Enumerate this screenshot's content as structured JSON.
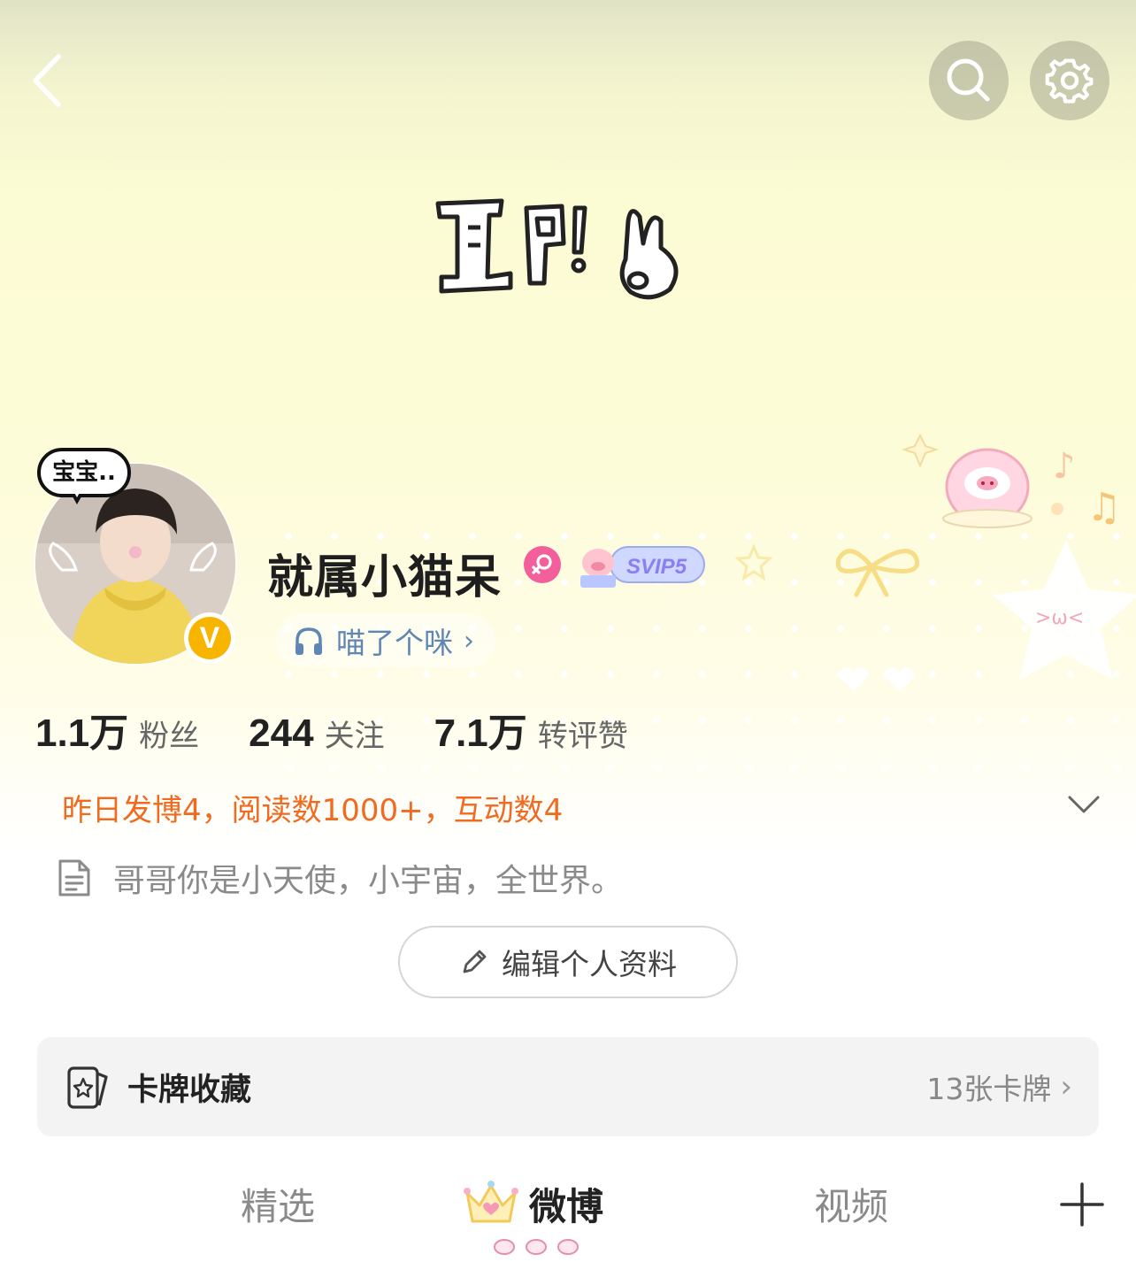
{
  "header": {
    "back_icon": "chevron-left-icon",
    "search_icon": "search-icon",
    "settings_icon": "gear-icon"
  },
  "profile": {
    "avatar_bubble": "宝宝..",
    "verified_badge": "V",
    "username": "就属小猫呆",
    "gender_icon": "female-icon",
    "vip_label": "SVIP5",
    "music_label": "喵了个咪",
    "music_chevron": "›"
  },
  "stats": [
    {
      "value": "1.1万",
      "label": "粉丝"
    },
    {
      "value": "244",
      "label": "关注"
    },
    {
      "value": "7.1万",
      "label": "转评赞"
    }
  ],
  "yesterday_summary": "昨日发博4，阅读数1000+，互动数4",
  "bio": "哥哥你是小天使，小宇宙，全世界。",
  "edit_profile_label": "编辑个人资料",
  "card_collection": {
    "title": "卡牌收藏",
    "count": "13张卡牌",
    "chevron": "›"
  },
  "tabs": [
    {
      "label": "精选",
      "active": false
    },
    {
      "label": "微博",
      "active": true
    },
    {
      "label": "视频",
      "active": false
    }
  ],
  "colors": {
    "accent_orange": "#f06a1f",
    "link_blue": "#5f86b5",
    "verified_gold": "#f7b500",
    "female_pink": "#f35f9b"
  }
}
